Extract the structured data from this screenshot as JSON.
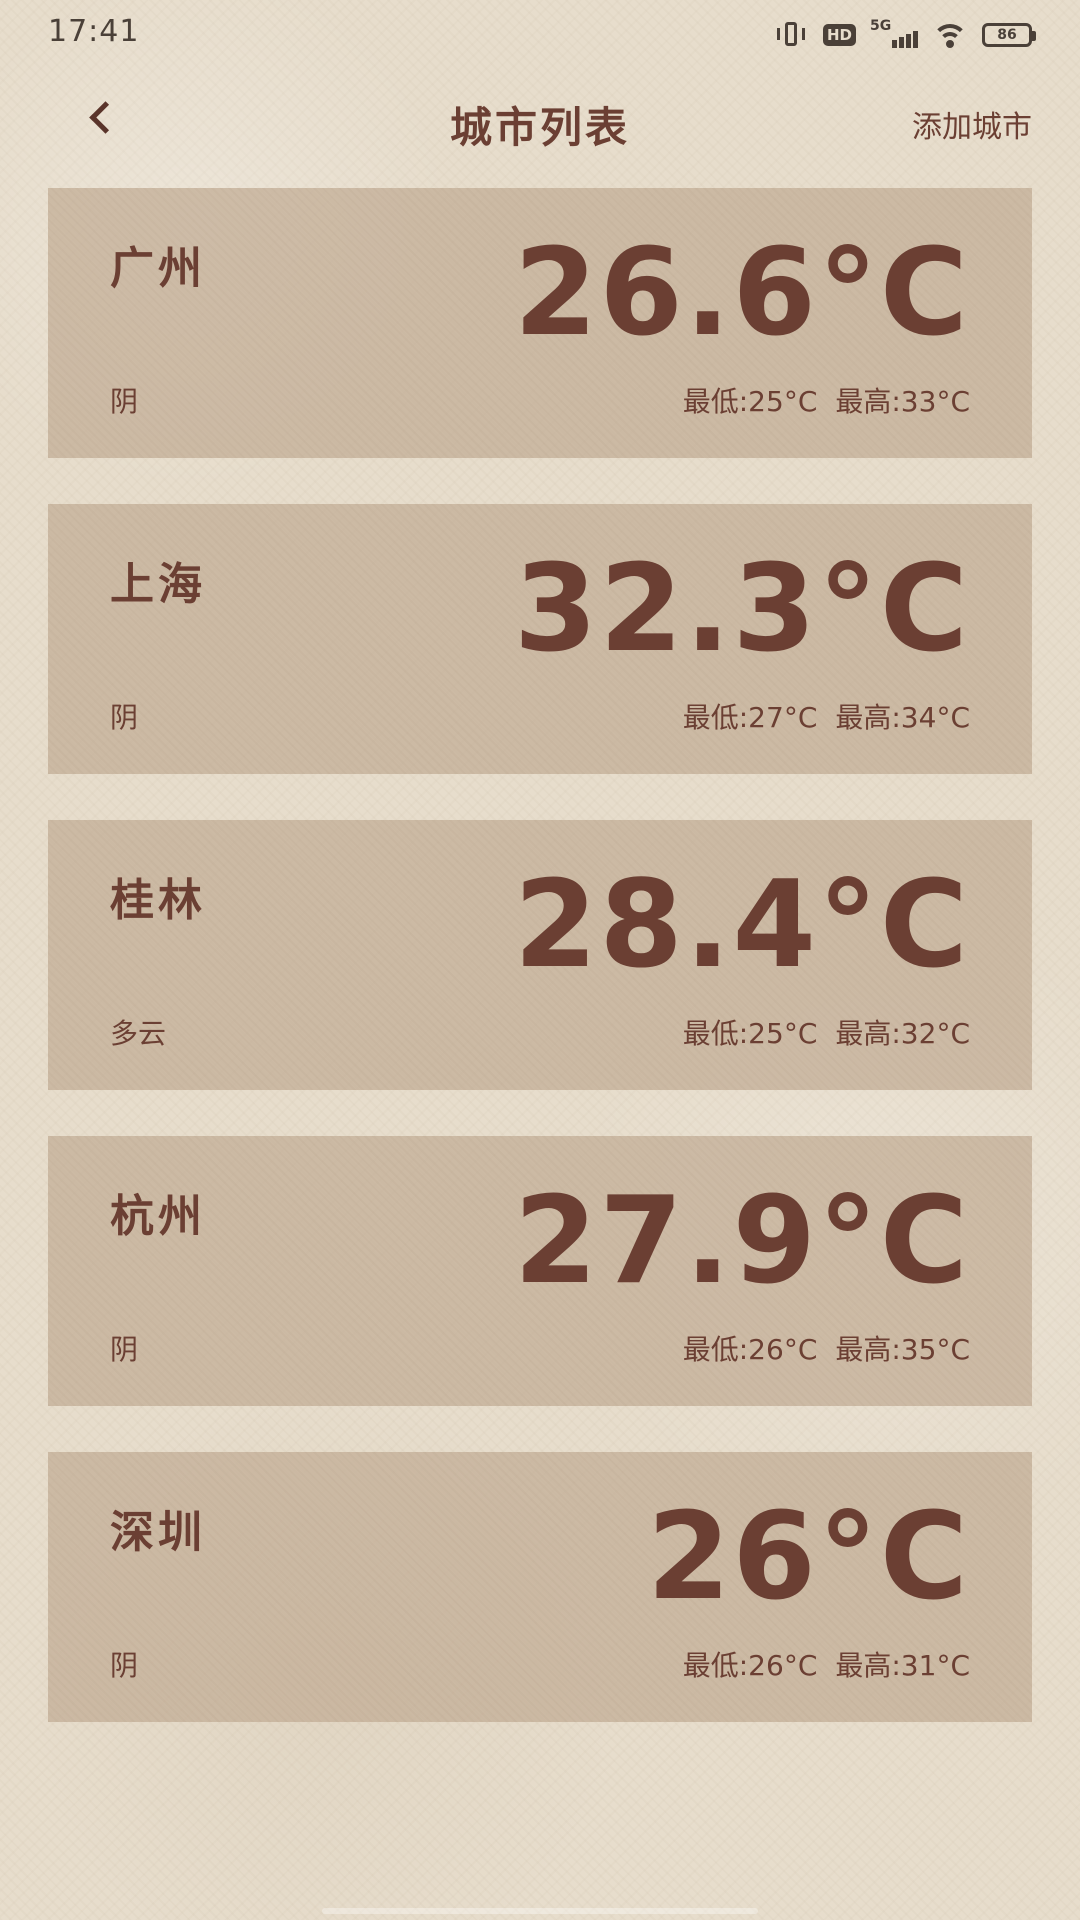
{
  "status_bar": {
    "time": "17:41",
    "network_label": "5G",
    "hd_label": "HD",
    "battery": "86",
    "icons": [
      "vibrate-icon",
      "hd-icon",
      "signal-5g-icon",
      "wifi-icon",
      "battery-icon"
    ]
  },
  "header": {
    "title": "城市列表",
    "add_city_label": "添加城市",
    "back_icon": "chevron-left-icon"
  },
  "colors": {
    "background": "#e7ddcc",
    "card": "#c4b098",
    "text": "#6b3f33"
  },
  "cities": [
    {
      "name": "广州",
      "condition": "阴",
      "temp": "26.6°C",
      "low": "最低:25°C",
      "high": "最高:33°C"
    },
    {
      "name": "上海",
      "condition": "阴",
      "temp": "32.3°C",
      "low": "最低:27°C",
      "high": "最高:34°C"
    },
    {
      "name": "桂林",
      "condition": "多云",
      "temp": "28.4°C",
      "low": "最低:25°C",
      "high": "最高:32°C"
    },
    {
      "name": "杭州",
      "condition": "阴",
      "temp": "27.9°C",
      "low": "最低:26°C",
      "high": "最高:35°C"
    },
    {
      "name": "深圳",
      "condition": "阴",
      "temp": "26°C",
      "low": "最低:26°C",
      "high": "最高:31°C"
    }
  ]
}
